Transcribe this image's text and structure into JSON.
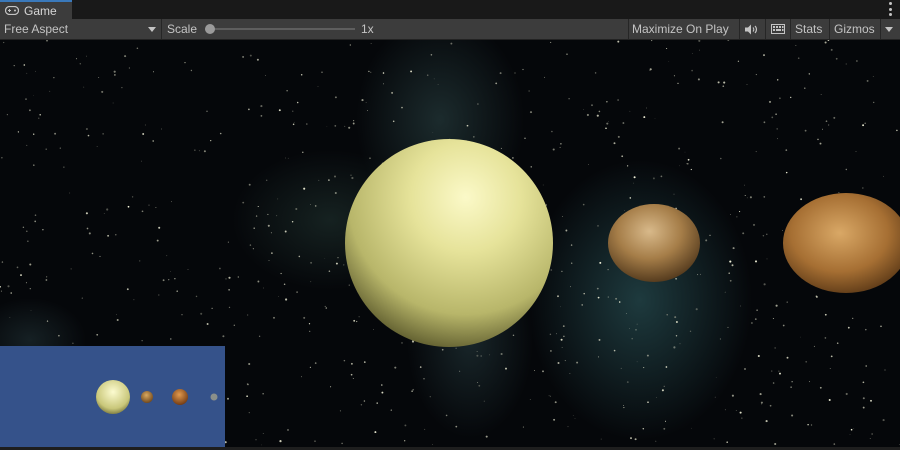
{
  "window": {
    "tab_label": "Game",
    "tab_icon": "gamepad-icon",
    "menu_icon": "kebab-menu-icon"
  },
  "toolbar": {
    "aspect_label": "Free Aspect",
    "scale_label": "Scale",
    "scale_value": "1x",
    "maximize_label": "Maximize On Play",
    "audio_icon": "speaker-icon",
    "keyboard_icon": "keyboard-icon",
    "stats_label": "Stats",
    "gizmos_label": "Gizmos"
  },
  "scene": {
    "background": "starfield-nebula",
    "planets": [
      "sun",
      "rocky-planet",
      "rocky-planet-right"
    ],
    "minimap": {
      "background_color": "#35528a",
      "planets": [
        "sun",
        "planet",
        "planet",
        "planet"
      ]
    }
  },
  "colors": {
    "tab_accent": "#3a79bb",
    "toolbar_bg": "#3c3c3c",
    "panel_bg": "#191919",
    "text": "#c4c4c4"
  }
}
